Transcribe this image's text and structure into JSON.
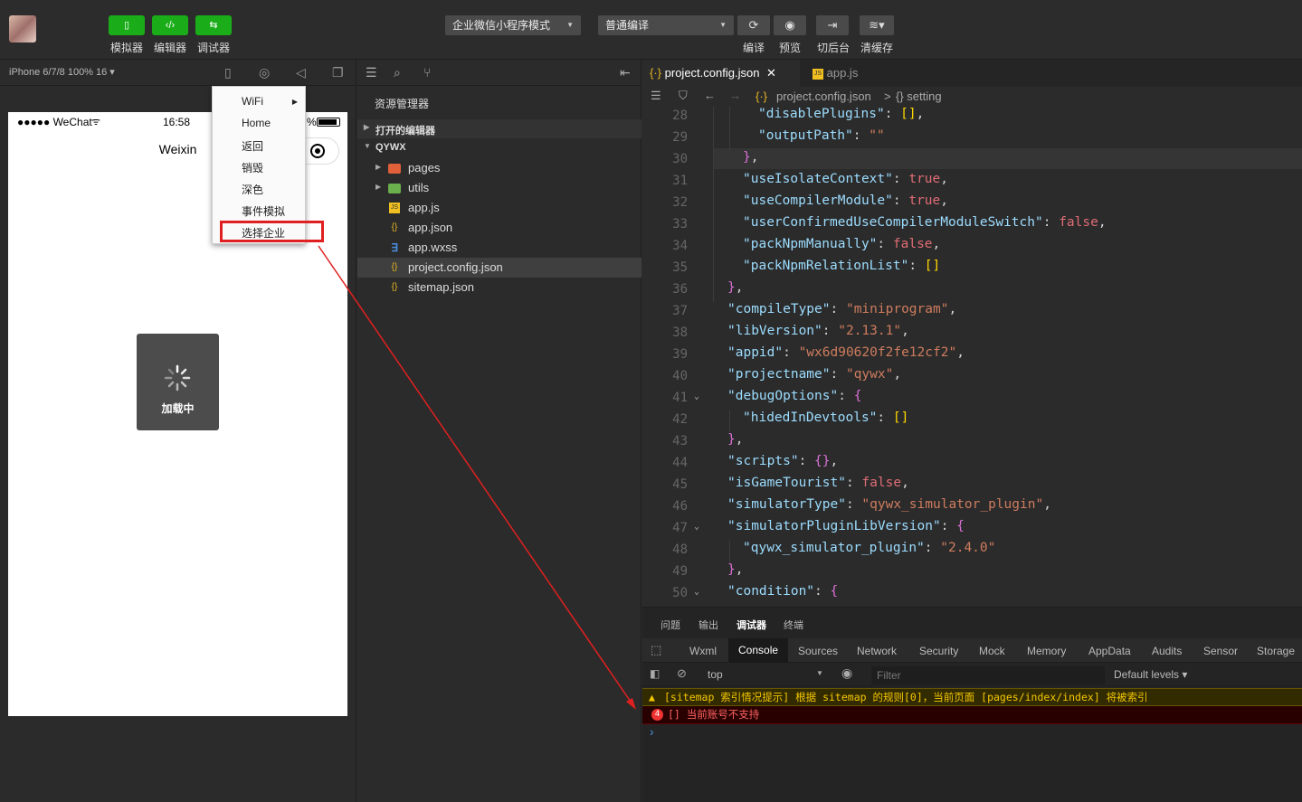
{
  "toolbar": {
    "buttons": [
      {
        "label": "模拟器",
        "icon": "phone-icon"
      },
      {
        "label": "编辑器",
        "icon": "code-icon"
      },
      {
        "label": "调试器",
        "icon": "debug-icon"
      }
    ],
    "mode_select": "企业微信小程序模式",
    "compile_select": "普通编译",
    "actions": [
      {
        "label": "编译",
        "icon": "refresh-icon"
      },
      {
        "label": "预览",
        "icon": "eye-icon"
      },
      {
        "label": "切后台",
        "icon": "switch-icon"
      },
      {
        "label": "清缓存",
        "icon": "layers-icon"
      }
    ],
    "accent": "#1aad19"
  },
  "simulator": {
    "device": "iPhone 6/7/8 100% 16 ▾",
    "status_signal": "●●●●● WeChat",
    "status_time": "16:58",
    "status_pct": "%",
    "nav_title": "Weixin",
    "loading_text": "加载中",
    "menu": [
      "WiFi",
      "Home",
      "返回",
      "销毁",
      "深色",
      "事件模拟",
      "选择企业"
    ]
  },
  "explorer": {
    "title": "资源管理器",
    "open_editors": "打开的编辑器",
    "project": "QYWX",
    "files": [
      {
        "name": "pages",
        "icon": "folder-icon"
      },
      {
        "name": "utils",
        "icon": "folder-icon"
      },
      {
        "name": "app.js",
        "icon": "js-icon"
      },
      {
        "name": "app.json",
        "icon": "json-icon"
      },
      {
        "name": "app.wxss",
        "icon": "css-icon"
      },
      {
        "name": "project.config.json",
        "icon": "json-icon"
      },
      {
        "name": "sitemap.json",
        "icon": "json-icon"
      }
    ]
  },
  "editor": {
    "tabs": [
      "project.config.json",
      "app.js"
    ],
    "breadcrumb_file": "project.config.json",
    "breadcrumb_sep": ">",
    "breadcrumb_node": "{} setting",
    "line_numbers": [
      "28",
      "29",
      "30",
      "31",
      "32",
      "33",
      "34",
      "35",
      "36",
      "37",
      "38",
      "39",
      "40",
      "41",
      "42",
      "43",
      "44",
      "45",
      "46",
      "47",
      "48",
      "49",
      "50"
    ],
    "lines": [
      "\"disablePlugins\": [],",
      "\"outputPath\": \"\"",
      "},",
      "\"useIsolateContext\": true,",
      "\"useCompilerModule\": true,",
      "\"userConfirmedUseCompilerModuleSwitch\": false,",
      "\"packNpmManually\": false,",
      "\"packNpmRelationList\": []",
      "},",
      "\"compileType\": \"miniprogram\",",
      "\"libVersion\": \"2.13.1\",",
      "\"appid\": \"wx6d90620f2fe12cf2\",",
      "\"projectname\": \"qywx\",",
      "\"debugOptions\": {",
      "\"hidedInDevtools\": []",
      "},",
      "\"scripts\": {},",
      "\"isGameTourist\": false,",
      "\"simulatorType\": \"qywx_simulator_plugin\",",
      "\"simulatorPluginLibVersion\": {",
      "\"qywx_simulator_plugin\": \"2.4.0\"",
      "},",
      "\"condition\": {"
    ]
  },
  "devtools": {
    "top_tabs": [
      "问题",
      "输出",
      "调试器",
      "终端"
    ],
    "tabs": [
      "Wxml",
      "Console",
      "Sources",
      "Network",
      "Security",
      "Mock",
      "Memory",
      "AppData",
      "Audits",
      "Sensor",
      "Storage"
    ],
    "context": "top",
    "filter_placeholder": "Filter",
    "levels": "Default levels ▾",
    "warning": "[sitemap 索引情况提示] 根据 sitemap 的规则[0]，当前页面 [pages/index/index] 将被索引",
    "error_count": "4",
    "error": "[] 当前账号不支持",
    "prompt": "›"
  }
}
